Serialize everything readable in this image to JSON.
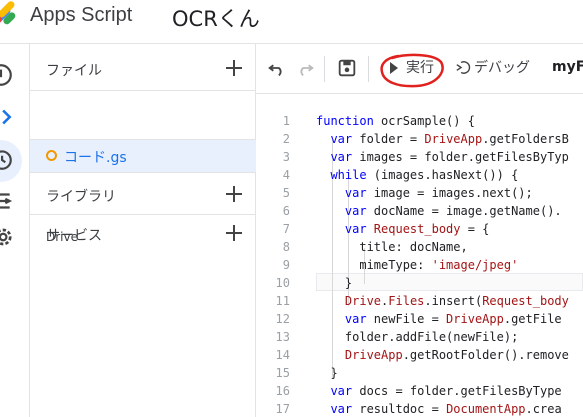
{
  "header": {
    "app_name": "Apps Script",
    "project_name": "OCRくん"
  },
  "sidebar": {
    "files_label": "ファイル",
    "file_name": "コード.gs",
    "libraries_label": "ライブラリ",
    "services_label": "サービス",
    "drive_label": "Drive"
  },
  "toolbar": {
    "run_label": "実行",
    "debug_label": "デバッグ",
    "function_name": "myFu"
  },
  "editor": {
    "line_numbers": [
      "1",
      "2",
      "3",
      "4",
      "5",
      "6",
      "7",
      "8",
      "9",
      "10",
      "11",
      "12",
      "13",
      "14",
      "15",
      "16",
      "17"
    ],
    "lines": [
      [
        {
          "t": "function ",
          "c": "kw"
        },
        {
          "t": "ocrSample() {",
          "c": "id"
        }
      ],
      [
        {
          "t": "  var ",
          "c": "kw"
        },
        {
          "t": "folder = ",
          "c": "id"
        },
        {
          "t": "DriveApp",
          "c": "fn"
        },
        {
          "t": ".getFoldersB",
          "c": "id"
        }
      ],
      [
        {
          "t": "  var ",
          "c": "kw"
        },
        {
          "t": "images = folder.getFilesByTyp",
          "c": "id"
        }
      ],
      [
        {
          "t": "  while ",
          "c": "kw"
        },
        {
          "t": "(images.hasNext()) {",
          "c": "id"
        }
      ],
      [
        {
          "t": "    var ",
          "c": "kw"
        },
        {
          "t": "image = images.next();",
          "c": "id"
        }
      ],
      [
        {
          "t": "    var ",
          "c": "kw"
        },
        {
          "t": "docName = image.getName().",
          "c": "id"
        }
      ],
      [
        {
          "t": "    var ",
          "c": "kw"
        },
        {
          "t": "Request_body",
          "c": "fn"
        },
        {
          "t": " = {",
          "c": "id"
        }
      ],
      [
        {
          "t": "      title: docName,",
          "c": "id"
        }
      ],
      [
        {
          "t": "      mimeType: ",
          "c": "id"
        },
        {
          "t": "'image/jpeg'",
          "c": "str"
        }
      ],
      [
        {
          "t": "    }",
          "c": "id"
        }
      ],
      [
        {
          "t": "    ",
          "c": "id"
        },
        {
          "t": "Drive",
          "c": "fn"
        },
        {
          "t": ".",
          "c": "id"
        },
        {
          "t": "Files",
          "c": "fn"
        },
        {
          "t": ".insert(",
          "c": "id"
        },
        {
          "t": "Request_body",
          "c": "fn"
        }
      ],
      [
        {
          "t": "    var ",
          "c": "kw"
        },
        {
          "t": "newFile = ",
          "c": "id"
        },
        {
          "t": "DriveApp",
          "c": "fn"
        },
        {
          "t": ".getFile",
          "c": "id"
        }
      ],
      [
        {
          "t": "    folder.addFile(newFile);",
          "c": "id"
        }
      ],
      [
        {
          "t": "    ",
          "c": "id"
        },
        {
          "t": "DriveApp",
          "c": "fn"
        },
        {
          "t": ".getRootFolder().remove",
          "c": "id"
        }
      ],
      [
        {
          "t": "  }",
          "c": "id"
        }
      ],
      [
        {
          "t": "  var ",
          "c": "kw"
        },
        {
          "t": "docs = folder.getFilesByType",
          "c": "id"
        }
      ],
      [
        {
          "t": "  var ",
          "c": "kw"
        },
        {
          "t": "resultdoc = ",
          "c": "id"
        },
        {
          "t": "DocumentApp",
          "c": "fn"
        },
        {
          "t": ".crea",
          "c": "id"
        }
      ]
    ]
  },
  "colors": {
    "accent": "#1a73e8",
    "selected_bg": "#e8f0fe",
    "keyword": "#0000ff",
    "identifier_red": "#a31515",
    "annotation_red": "#e0211d"
  },
  "icons": {
    "rail": [
      "info-icon",
      "code-chevron-icon",
      "clock-trigger-icon",
      "executions-icon",
      "settings-gear-icon"
    ],
    "toolbar": [
      "undo-icon",
      "redo-icon",
      "save-icon",
      "run-icon",
      "debug-icon"
    ]
  }
}
